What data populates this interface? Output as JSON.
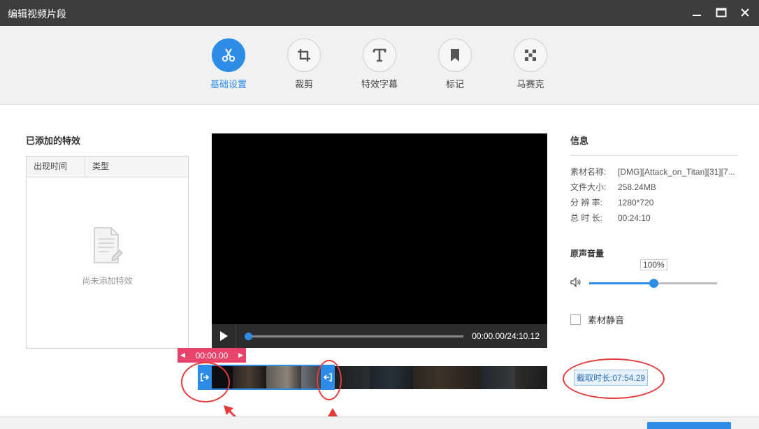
{
  "window": {
    "title": "编辑视频片段"
  },
  "toolbar": {
    "tabs": [
      {
        "label": "基础设置",
        "icon": "scissors-icon",
        "active": true
      },
      {
        "label": "裁剪",
        "icon": "crop-icon",
        "active": false
      },
      {
        "label": "特效字幕",
        "icon": "text-icon",
        "active": false
      },
      {
        "label": "标记",
        "icon": "bookmark-icon",
        "active": false
      },
      {
        "label": "马赛克",
        "icon": "mosaic-icon",
        "active": false
      }
    ]
  },
  "effects": {
    "title": "已添加的特效",
    "columns": [
      "出现时间",
      "类型"
    ],
    "empty_text": "尚未添加特效"
  },
  "player": {
    "timecode": "00:00.00/24:10.12",
    "progress": 0
  },
  "timeline": {
    "start_time": "00:00.00",
    "duration_label": "截取时长:07:54.29"
  },
  "info": {
    "title": "信息",
    "rows": [
      {
        "key": "素材名称:",
        "value": "[DMG][Attack_on_Titan][31][7..."
      },
      {
        "key": "文件大小:",
        "value": "258.24MB"
      },
      {
        "key": "分 辨 率:",
        "value": "1280*720"
      },
      {
        "key": "总 时 长:",
        "value": "00:24:10"
      }
    ]
  },
  "volume": {
    "title": "原声音量",
    "value_label": "100%",
    "level": 0.5
  },
  "mute": {
    "label": "素材静音",
    "checked": false
  },
  "colors": {
    "accent": "#2c8ce8",
    "start_tag": "#e8436a",
    "annotation": "#e53a3a"
  }
}
